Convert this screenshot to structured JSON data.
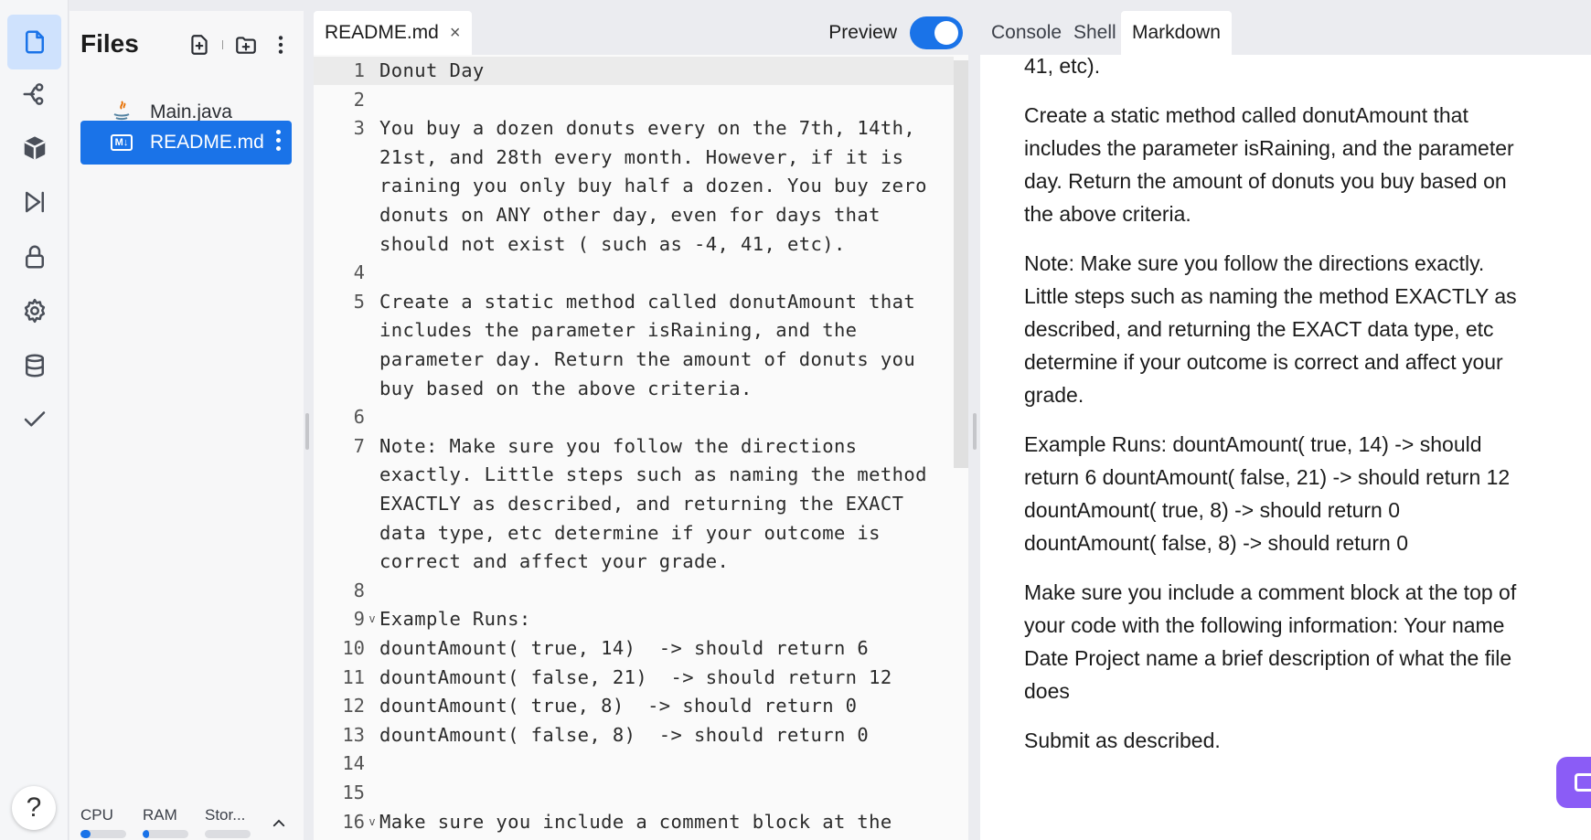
{
  "activity_bar": {
    "items": [
      {
        "name": "files-icon",
        "active": true
      },
      {
        "name": "git-branch-icon",
        "active": false
      },
      {
        "name": "package-icon",
        "active": false
      },
      {
        "name": "debug-run-icon",
        "active": false
      },
      {
        "name": "lock-icon",
        "active": false
      },
      {
        "name": "gear-icon",
        "active": false
      },
      {
        "name": "database-icon",
        "active": false
      },
      {
        "name": "check-icon",
        "active": false
      }
    ],
    "help_label": "?"
  },
  "files_panel": {
    "title": "Files",
    "items": [
      {
        "label": "Main.java",
        "icon": "java-icon",
        "selected": false
      },
      {
        "label": "README.md",
        "icon": "markdown-icon",
        "icon_text": "M↓",
        "selected": true
      }
    ],
    "resources": [
      {
        "label": "CPU",
        "level": 0.22
      },
      {
        "label": "RAM",
        "level": 0.14
      },
      {
        "label": "Stor...",
        "level": 0
      }
    ]
  },
  "editor": {
    "tab_label": "README.md",
    "tab_close": "×",
    "preview_label": "Preview",
    "preview_on": true,
    "lines": [
      {
        "n": "1",
        "text": "Donut Day",
        "fold": ""
      },
      {
        "n": "2",
        "text": "",
        "fold": ""
      },
      {
        "n": "3",
        "text": "You buy a dozen donuts every on the 7th, 14th,",
        "fold": ""
      },
      {
        "n": "",
        "text": "21st, and 28th every month. However, if it is",
        "fold": ""
      },
      {
        "n": "",
        "text": "raining you only buy half a dozen. You buy zero",
        "fold": ""
      },
      {
        "n": "",
        "text": "donuts on ANY other day, even for days that",
        "fold": ""
      },
      {
        "n": "",
        "text": "should not exist ( such as -4, 41, etc).",
        "fold": ""
      },
      {
        "n": "4",
        "text": "",
        "fold": ""
      },
      {
        "n": "5",
        "text": "Create a static method called donutAmount that",
        "fold": ""
      },
      {
        "n": "",
        "text": "includes the parameter isRaining, and the",
        "fold": ""
      },
      {
        "n": "",
        "text": "parameter day. Return the amount of donuts you",
        "fold": ""
      },
      {
        "n": "",
        "text": "buy based on the above criteria.",
        "fold": ""
      },
      {
        "n": "6",
        "text": "",
        "fold": ""
      },
      {
        "n": "7",
        "text": "Note: Make sure you follow the directions",
        "fold": ""
      },
      {
        "n": "",
        "text": "exactly. Little steps such as naming the method",
        "fold": ""
      },
      {
        "n": "",
        "text": "EXACTLY as described, and returning the EXACT",
        "fold": ""
      },
      {
        "n": "",
        "text": "data type, etc determine if your outcome is",
        "fold": ""
      },
      {
        "n": "",
        "text": "correct and affect your grade.",
        "fold": ""
      },
      {
        "n": "8",
        "text": "",
        "fold": ""
      },
      {
        "n": "9",
        "text": "Example Runs:",
        "fold": "v"
      },
      {
        "n": "10",
        "text": "dountAmount( true, 14)  -> should return 6",
        "fold": ""
      },
      {
        "n": "11",
        "text": "dountAmount( false, 21)  -> should return 12",
        "fold": ""
      },
      {
        "n": "12",
        "text": "dountAmount( true, 8)  -> should return 0",
        "fold": ""
      },
      {
        "n": "13",
        "text": "dountAmount( false, 8)  -> should return 0",
        "fold": ""
      },
      {
        "n": "14",
        "text": "",
        "fold": ""
      },
      {
        "n": "15",
        "text": "",
        "fold": ""
      },
      {
        "n": "16",
        "text": "Make sure you include a comment block at the",
        "fold": "v"
      }
    ]
  },
  "right_panel": {
    "tabs": [
      {
        "label": "Console",
        "active": false
      },
      {
        "label": "Shell",
        "active": false
      },
      {
        "label": "Markdown",
        "active": true
      }
    ],
    "paragraphs": [
      [
        "41, etc)."
      ],
      [
        "Create a static method called donutAmount that",
        "includes the parameter isRaining, and the parameter",
        "day. Return the amount of donuts you buy based on",
        "the above criteria."
      ],
      [
        "Note: Make sure you follow the directions exactly.",
        "Little steps such as naming the method EXACTLY as",
        "described, and returning the EXACT data type, etc",
        "determine if your outcome is correct and affect your",
        "grade."
      ],
      [
        "Example Runs: dountAmount( true, 14) -> should",
        "return 6 dountAmount( false, 21) -> should return 12",
        "dountAmount( true, 8) -> should return 0",
        "dountAmount( false, 8) -> should return 0"
      ],
      [
        "Make sure you include a comment block at the top of",
        "your code with the following information: Your name",
        "Date Project name a brief description of what the file",
        "does"
      ],
      [
        "Submit as described."
      ]
    ]
  },
  "colors": {
    "accent": "#1a73e8",
    "fab": "#8b5cf6"
  }
}
